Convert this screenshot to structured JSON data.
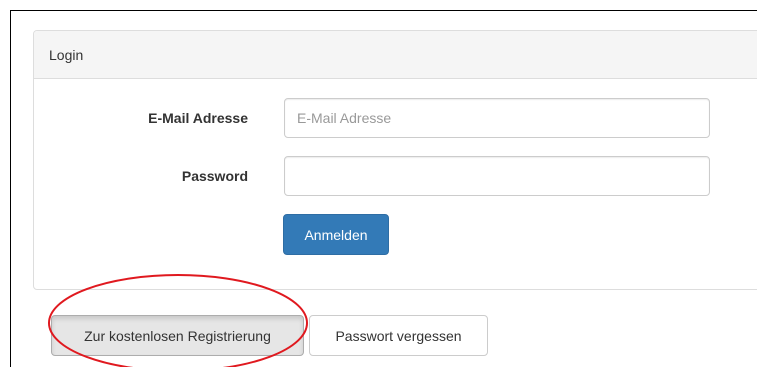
{
  "panel": {
    "heading": "Login"
  },
  "form": {
    "email_label": "E-Mail Adresse",
    "email_placeholder": "E-Mail Adresse",
    "email_value": "",
    "password_label": "Password",
    "password_value": "",
    "submit_label": "Anmelden"
  },
  "actions": {
    "register_label": "Zur kostenlosen Registrierung",
    "forgot_label": "Passwort vergessen"
  },
  "colors": {
    "primary": "#337ab7",
    "highlight": "#e0191f"
  }
}
